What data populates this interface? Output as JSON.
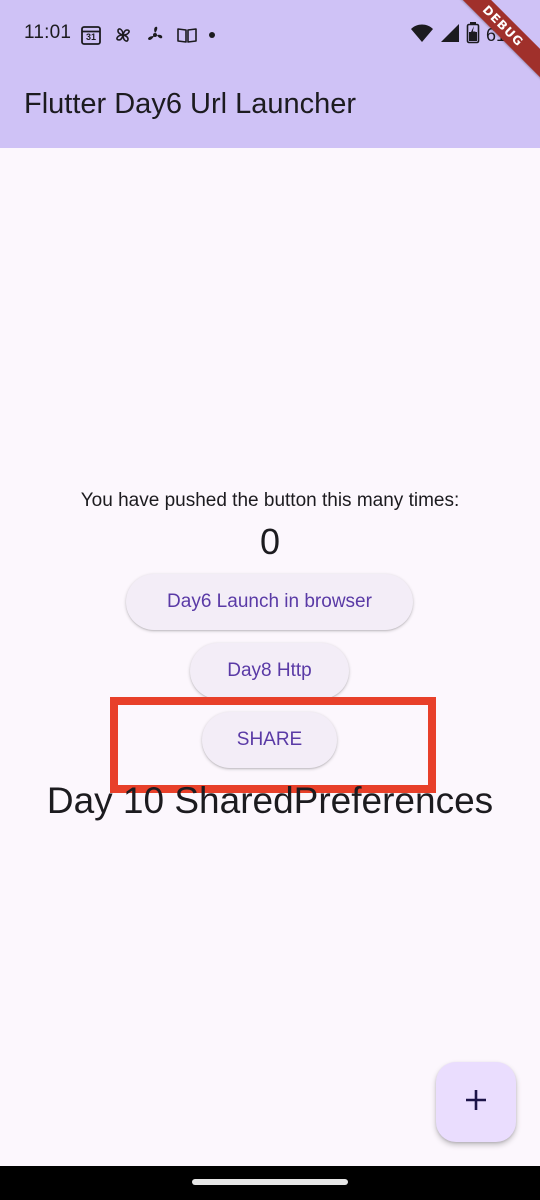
{
  "status_bar": {
    "time": "11:01",
    "calendar_day": "31",
    "battery_percent": "61%",
    "left_icons": [
      "calendar-icon",
      "pinwheel-icon",
      "fan-icon",
      "book-icon",
      "dot-icon"
    ],
    "right_icons": [
      "wifi-icon",
      "cell-signal-icon",
      "battery-icon"
    ]
  },
  "debug_banner": "DEBUG",
  "app_bar": {
    "title": "Flutter Day6 Url Launcher"
  },
  "body": {
    "counter_label": "You have pushed the button this many times:",
    "counter_value": "0",
    "buttons": {
      "launch": "Day6 Launch in browser",
      "http": "Day8 Http",
      "share": "SHARE"
    },
    "shared_prefs_title": "Day 10 SharedPreferences"
  },
  "fab": {
    "icon": "plus-icon"
  },
  "colors": {
    "app_bar": "#cfc2f6",
    "background": "#fcf7fd",
    "button_bg": "#f3edf7",
    "button_text": "#5a3aa6",
    "fab_bg": "#eaddfe",
    "highlight": "#e8402a",
    "debug_banner": "#a0302b"
  }
}
